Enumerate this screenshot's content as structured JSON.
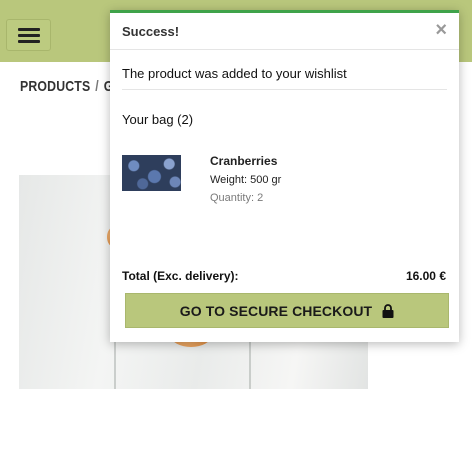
{
  "header": {
    "menu_icon": "hamburger-icon",
    "bg_color": "#b9c77c"
  },
  "breadcrumb": {
    "items": [
      "PRODUCTS",
      "G"
    ],
    "separator": "/"
  },
  "modal": {
    "title": "Success!",
    "close_label": "×",
    "notice": "The product was added to your wishlist",
    "bag_title": "Your bag (2)",
    "item": {
      "name": "Cranberries",
      "weight": "Weight: 500 gr",
      "quantity": "Quantity: 2"
    },
    "total_label": "Total (Exc. delivery):",
    "total_value": "16.00 €",
    "checkout_label": "GO TO SECURE CHECKOUT",
    "checkout_icon": "lock-icon",
    "accent_color": "#3fa34a"
  }
}
